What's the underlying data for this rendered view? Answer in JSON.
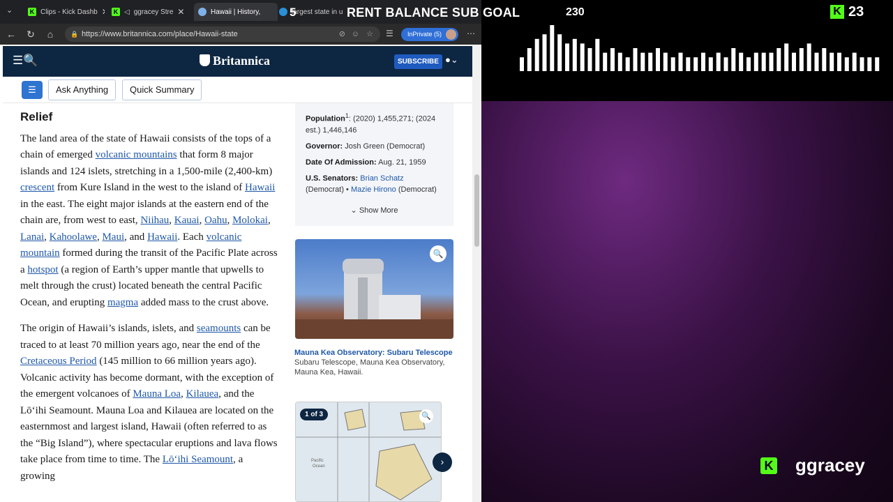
{
  "tabs": [
    {
      "label": "Clips - Kick Dashb",
      "icon": "kick-icon",
      "active": false
    },
    {
      "label": "ggracey Stre",
      "icon": "kick-icon",
      "active": false
    },
    {
      "label": "Hawaii | History,",
      "icon": "britannica-icon",
      "active": true
    },
    {
      "label": "largest state in u",
      "icon": "edge-icon",
      "active": false
    }
  ],
  "address": {
    "url": "https://www.britannica.com/place/Hawaii-state",
    "inprivate_label": "InPrivate (5)"
  },
  "site": {
    "logo": "Britannica",
    "subscribe_label": "SUBSCRIBE"
  },
  "toolbar": {
    "ask_label": "Ask Anything",
    "summary_label": "Quick Summary"
  },
  "article": {
    "heading": "Relief",
    "p1": [
      {
        "t": "The land area of the state of Hawaii consists of the tops of a chain of emerged "
      },
      {
        "t": "volcanic mountains",
        "link": true
      },
      {
        "t": " that form 8 major islands and 124 islets, stretching in a 1,500-mile (2,400-km) "
      },
      {
        "t": "crescent",
        "link": true
      },
      {
        "t": " from Kure Island in the west to the island of "
      },
      {
        "t": "Hawaii",
        "link": true
      },
      {
        "t": " in the east. The eight major islands at the eastern end of the chain are, from west to east, "
      },
      {
        "t": "Niihau",
        "link": true
      },
      {
        "t": ", "
      },
      {
        "t": "Kauai",
        "link": true
      },
      {
        "t": ", "
      },
      {
        "t": "Oahu",
        "link": true
      },
      {
        "t": ", "
      },
      {
        "t": "Molokai",
        "link": true
      },
      {
        "t": ", "
      },
      {
        "t": "Lanai",
        "link": true
      },
      {
        "t": ", "
      },
      {
        "t": "Kahoolawe",
        "link": true
      },
      {
        "t": ", "
      },
      {
        "t": "Maui",
        "link": true
      },
      {
        "t": ", and "
      },
      {
        "t": "Hawaii",
        "link": true
      },
      {
        "t": ". Each "
      },
      {
        "t": "volcanic mountain",
        "link": true
      },
      {
        "t": " formed during the transit of the Pacific Plate across a "
      },
      {
        "t": "hotspot",
        "link": true
      },
      {
        "t": " (a region of Earth’s upper mantle that upwells to melt through the crust) located beneath the central Pacific Ocean, and erupting "
      },
      {
        "t": "magma",
        "link": true
      },
      {
        "t": " added mass to the crust above."
      }
    ],
    "p2": [
      {
        "t": "The origin of Hawaii’s islands, islets, and "
      },
      {
        "t": "seamounts",
        "link": true
      },
      {
        "t": " can be traced to at least 70 million years ago, near the end of the "
      },
      {
        "t": "Cretaceous Period",
        "link": true
      },
      {
        "t": " (145 million to 66 million years ago). Volcanic activity has become dormant, with the exception of the emergent volcanoes of "
      },
      {
        "t": "Mauna Loa",
        "link": true
      },
      {
        "t": ", "
      },
      {
        "t": "Kilauea",
        "link": true
      },
      {
        "t": ", and the Lōʻihi Seamount. Mauna Loa and Kilauea are located on the easternmost and largest island, Hawaii (often referred to as the “Big Island”), where spectacular eruptions and lava flows take place from time to time. The "
      },
      {
        "t": "Lōʻihi Seamount",
        "link": true
      },
      {
        "t": ", a growing"
      }
    ]
  },
  "facts": {
    "population_label": "Population",
    "population_sup": "1",
    "population_value": ": (2020) 1,455,271; (2024 est.) 1,446,146",
    "governor_label": "Governor:",
    "governor_value": " Josh Green (Democrat)",
    "admission_label": "Date Of Admission:",
    "admission_value": " Aug. 21, 1959",
    "senators_label": "U.S. Senators:",
    "senator1": "Brian Schatz",
    "senator1_party": " (Democrat) • ",
    "senator2": "Mazie Hirono",
    "senator2_party": " (Democrat)",
    "show_more": "Show More"
  },
  "media": {
    "caption_title": "Mauna Kea Observatory: Subaru Telescope",
    "caption_text": " Subaru Telescope, Mauna Kea Observatory, Mauna Kea, Hawaii.",
    "gallery_badge": "1 of 3",
    "map_labels": [
      "Pacific",
      "Ocean"
    ]
  },
  "overlay": {
    "goal_count": "5",
    "goal_title": "RENT BALANCE SUB GOAL",
    "goal_number": "230",
    "viewer_count": "23",
    "streamer_name": "ggracey",
    "visualizer_levels": [
      0.3,
      0.5,
      0.7,
      0.8,
      1.0,
      0.8,
      0.6,
      0.7,
      0.6,
      0.5,
      0.7,
      0.4,
      0.5,
      0.4,
      0.3,
      0.5,
      0.4,
      0.4,
      0.5,
      0.4,
      0.3,
      0.4,
      0.3,
      0.3,
      0.4,
      0.3,
      0.4,
      0.3,
      0.5,
      0.4,
      0.3,
      0.4,
      0.4,
      0.4,
      0.5,
      0.6,
      0.4,
      0.5,
      0.6,
      0.4,
      0.5,
      0.4,
      0.4,
      0.3,
      0.4,
      0.3,
      0.3,
      0.3
    ],
    "colors": {
      "kick_green": "#53fc18",
      "britannica_navy": "#0d2642",
      "link_blue": "#1f58a8"
    }
  }
}
